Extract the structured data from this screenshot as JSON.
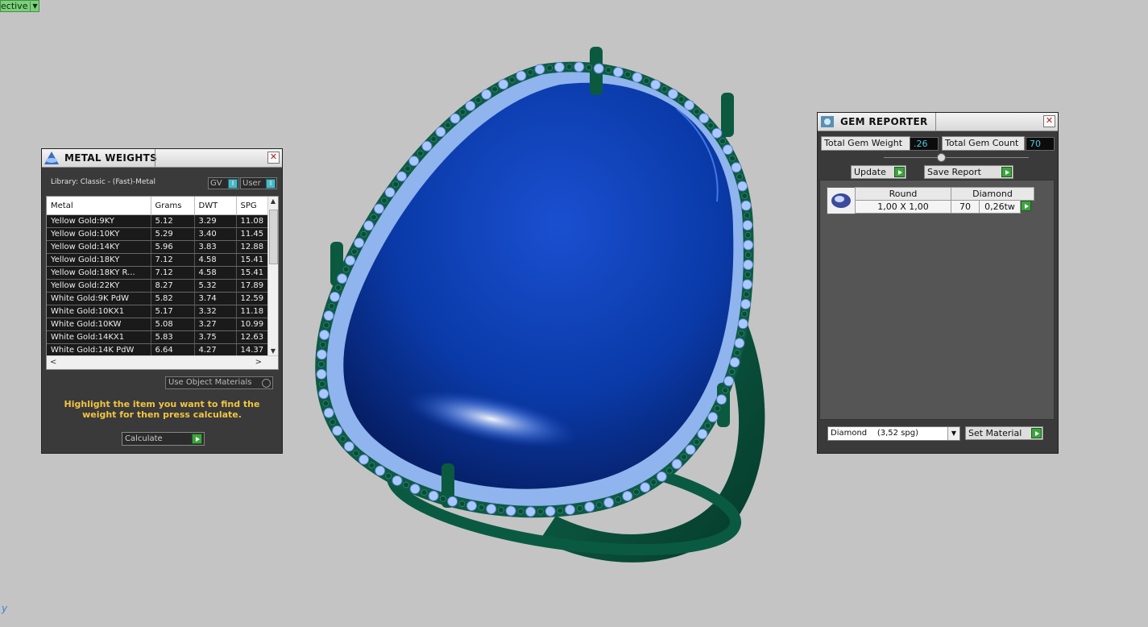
{
  "viewport": {
    "view_label": "ective",
    "axis_label": "y"
  },
  "metal_weights": {
    "title": "METAL WEIGHTS",
    "library": "Library: Classic - (Fast)-Metal",
    "toggle_gv": "GV",
    "toggle_user": "User",
    "columns": [
      "Metal",
      "Grams",
      "DWT",
      "SPG"
    ],
    "rows": [
      [
        "Yellow Gold:9KY",
        "5.12",
        "3.29",
        "11.08"
      ],
      [
        "Yellow Gold:10KY",
        "5.29",
        "3.40",
        "11.45"
      ],
      [
        "Yellow Gold:14KY",
        "5.96",
        "3.83",
        "12.88"
      ],
      [
        "Yellow Gold:18KY",
        "7.12",
        "4.58",
        "15.41"
      ],
      [
        "Yellow Gold:18KY R...",
        "7.12",
        "4.58",
        "15.41"
      ],
      [
        "Yellow Gold:22KY",
        "8.27",
        "5.32",
        "17.89"
      ],
      [
        "White Gold:9K PdW",
        "5.82",
        "3.74",
        "12.59"
      ],
      [
        "White Gold:10KX1",
        "5.17",
        "3.32",
        "11.18"
      ],
      [
        "White Gold:10KW",
        "5.08",
        "3.27",
        "10.99"
      ],
      [
        "White Gold:14KX1",
        "5.83",
        "3.75",
        "12.63"
      ],
      [
        "White Gold:14K PdW",
        "6.64",
        "4.27",
        "14.37"
      ]
    ],
    "use_object_materials": "Use Object Materials",
    "hint": "Highlight the item you want to find the weight for then press calculate.",
    "calculate_label": "Calculate"
  },
  "gem_reporter": {
    "title": "GEM REPORTER",
    "total_weight_label": "Total Gem Weight",
    "total_weight_value": ".26",
    "total_count_label": "Total Gem Count",
    "total_count_value": "70",
    "update_label": "Update",
    "save_report_label": "Save Report",
    "gems": [
      {
        "shape": "Round",
        "material": "Diamond",
        "size": "1,00 X 1,00",
        "count": "70",
        "weight": "0,26tw"
      }
    ],
    "material_select": "Diamond    (3,52 spg)",
    "set_material_label": "Set Material"
  },
  "colors": {
    "accent_green": "#3ea43e",
    "hint_yellow": "#f2c441",
    "value_cyan": "#4ec9e0"
  }
}
